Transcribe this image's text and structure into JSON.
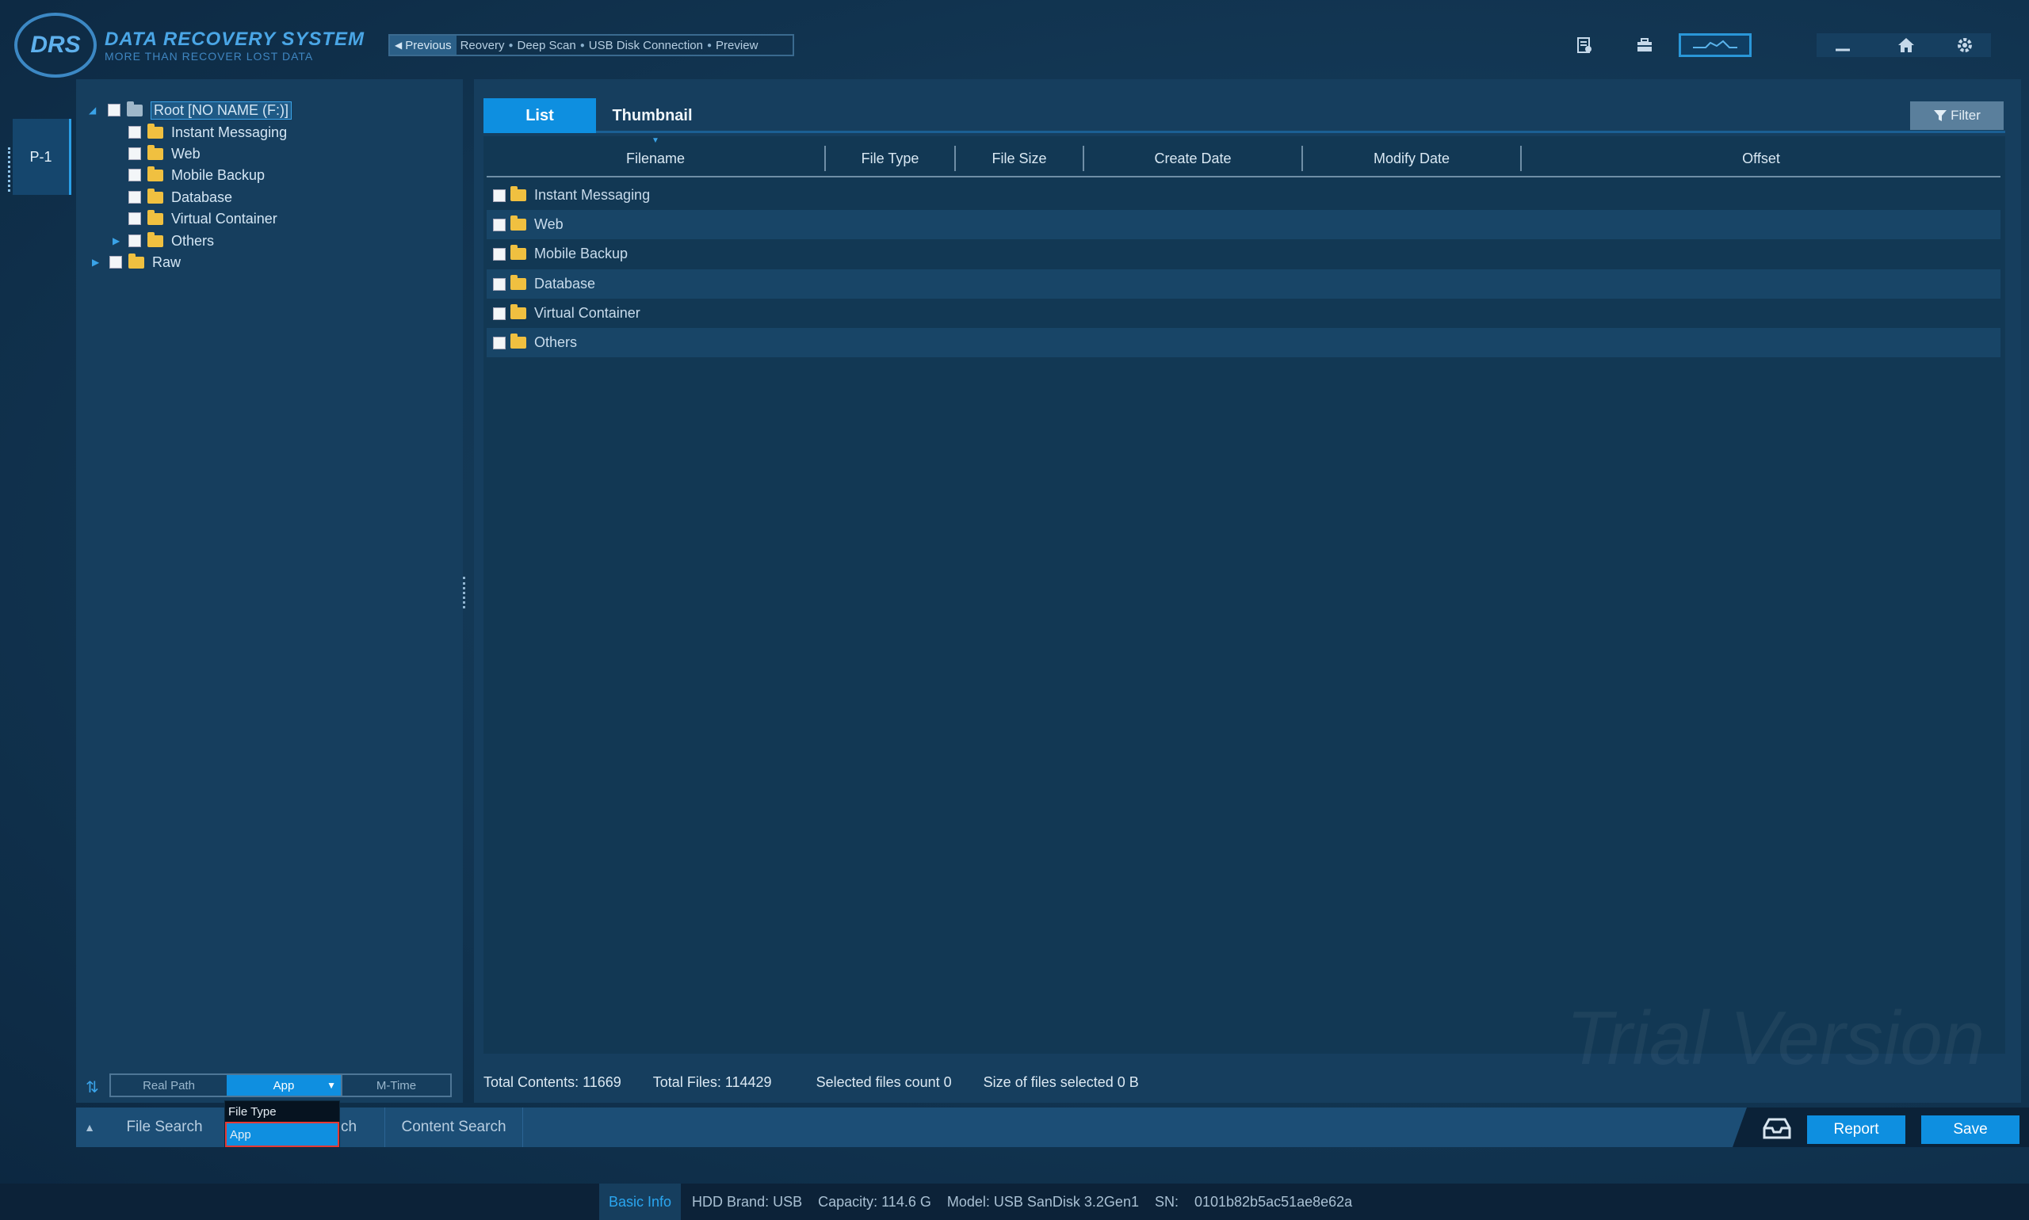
{
  "app": {
    "logo_mark": "DRS",
    "title": "DATA RECOVERY SYSTEM",
    "subtitle": "MORE THAN RECOVER LOST DATA"
  },
  "breadcrumb": {
    "previous": "Previous",
    "steps": [
      "Reovery",
      "Deep Scan",
      "USB Disk Connection",
      "Preview"
    ]
  },
  "toolbar_icons": [
    "scan-list-icon",
    "briefcase-icon",
    "graph-icon",
    "minimize-icon",
    "home-icon",
    "gear-icon"
  ],
  "side_tab": {
    "label": "P-1"
  },
  "tree": {
    "root": "Root [NO NAME    (F:)]",
    "children": [
      "Instant Messaging",
      "Web",
      "Mobile Backup",
      "Database",
      "Virtual Container",
      "Others"
    ],
    "raw": "Raw"
  },
  "sort": {
    "options": [
      "Real Path",
      "App",
      "M-Time"
    ],
    "selected": "App",
    "dropdown": [
      "File Type",
      "App"
    ]
  },
  "view_tabs": [
    "List",
    "Thumbnail"
  ],
  "filter_label": "Filter",
  "table": {
    "columns": [
      "Filename",
      "File Type",
      "File Size",
      "Create Date",
      "Modify Date",
      "Offset"
    ],
    "rows": [
      "Instant Messaging",
      "Web",
      "Mobile Backup",
      "Database",
      "Virtual Container",
      "Others"
    ]
  },
  "status": {
    "total_contents": "Total Contents: 11669",
    "total_files": "Total Files: 114429",
    "selected_count": "Selected files count  0",
    "selected_size": "Size of files  selected  0 B"
  },
  "bottom": {
    "file_search": "File Search",
    "hidden_search_fragment": "ch",
    "content_search": "Content Search",
    "report": "Report",
    "save": "Save"
  },
  "footer": {
    "basic_info": "Basic Info",
    "hdd_brand": "HDD Brand: USB",
    "capacity": "Capacity: 114.6 G",
    "model": "Model: USB SanDisk 3.2Gen1",
    "sn_label": "SN:",
    "sn_value": "0101b82b5ac51ae8e62a"
  },
  "watermark": "Trial Version",
  "colors": {
    "accent": "#0e8fe0",
    "panel": "#163e5e",
    "background": "#143a58",
    "folder": "#f0c040"
  }
}
